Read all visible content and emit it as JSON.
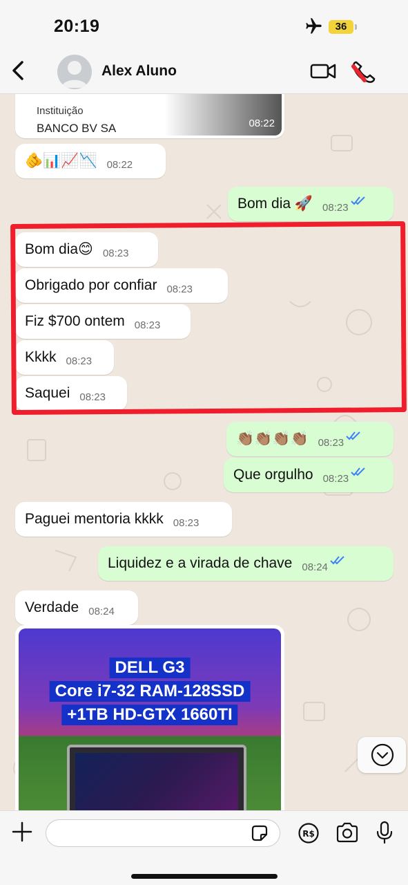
{
  "status_bar": {
    "time": "20:19",
    "battery": "36"
  },
  "header": {
    "contact_name": "Alex Aluno"
  },
  "colors": {
    "incoming": "#ffffff",
    "outgoing": "#d8fdd2",
    "highlight": "#f01e2c",
    "read_ticks": "#3b82f6"
  },
  "icons": [
    "back-icon",
    "avatar-icon",
    "video-icon",
    "phone-icon",
    "airplane-icon",
    "plus-icon",
    "sticker-icon",
    "payment-icon",
    "camera-icon",
    "mic-icon",
    "chevron-down-icon",
    "double-check-icon"
  ],
  "card": {
    "label": "Instituição",
    "value": "BANCO BV SA",
    "time": "08:22"
  },
  "messages": [
    {
      "text": "🫵📊📈📉",
      "time": "08:22"
    },
    {
      "text": "Bom dia 🚀",
      "time": "08:23"
    },
    {
      "text": "Bom dia😊",
      "time": "08:23"
    },
    {
      "text": "Obrigado por confiar",
      "time": "08:23"
    },
    {
      "text": "Fiz $700 ontem",
      "time": "08:23"
    },
    {
      "text": "Kkkk",
      "time": "08:23"
    },
    {
      "text": "Saquei",
      "time": "08:23"
    },
    {
      "text": "👏🏽👏🏽👏🏽👏🏽",
      "time": "08:23"
    },
    {
      "text": "Que orgulho",
      "time": "08:23"
    },
    {
      "text": "Paguei mentoria kkkk",
      "time": "08:23"
    },
    {
      "text": "Liquidez e a virada de chave",
      "time": "08:24"
    },
    {
      "text": "Verdade",
      "time": "08:24"
    }
  ],
  "image_message": {
    "lines": [
      "DELL G3",
      "Core i7-32 RAM-128SSD",
      "+1TB HD-GTX 1660TI"
    ]
  }
}
